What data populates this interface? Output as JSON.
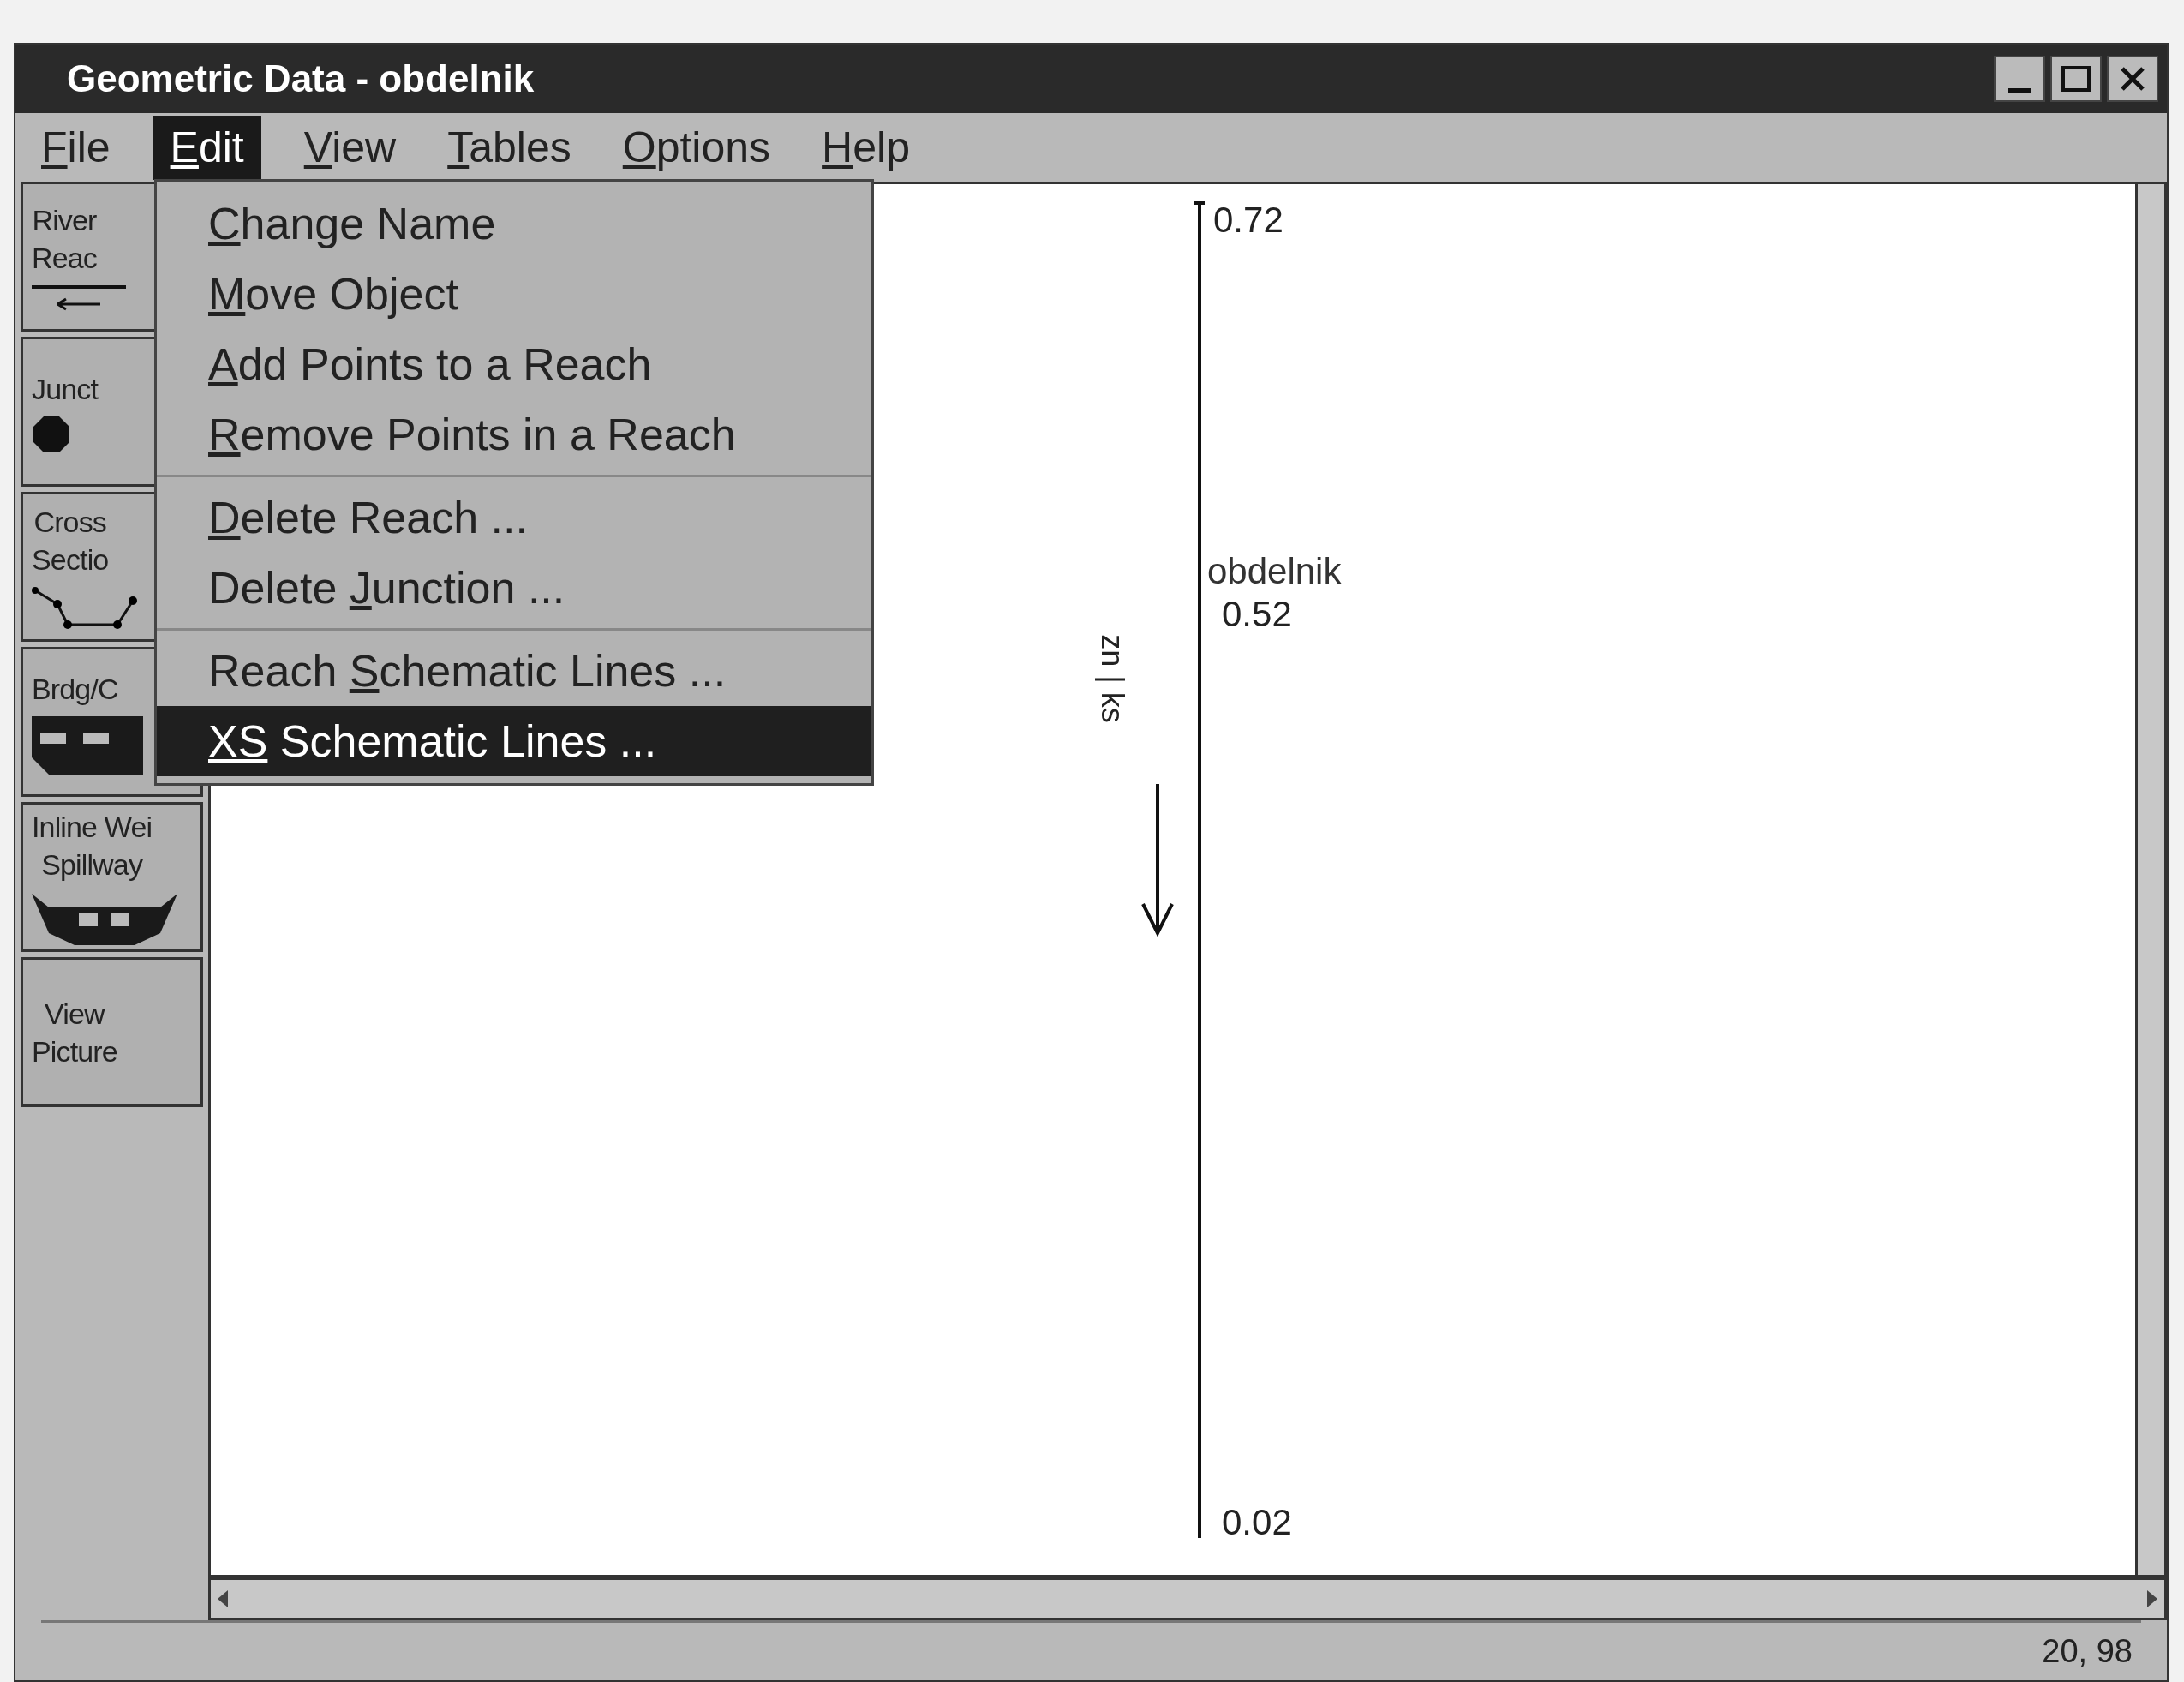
{
  "window": {
    "title": "Geometric Data - obdelnik"
  },
  "menu_bar": [
    {
      "key": "F",
      "after": "ile",
      "selected": false
    },
    {
      "key": "E",
      "after": "dit",
      "selected": true
    },
    {
      "key": "V",
      "after": "iew",
      "selected": false
    },
    {
      "key": "T",
      "after": "ables",
      "selected": false
    },
    {
      "key": "O",
      "after": "ptions",
      "selected": false
    },
    {
      "key": "H",
      "after": "elp",
      "selected": false
    }
  ],
  "edit_menu": [
    [
      {
        "key": "C",
        "after": "hange Name",
        "selected": false
      },
      {
        "key": "M",
        "after": "ove Object",
        "selected": false
      },
      {
        "key": "A",
        "after": "dd Points to a Reach",
        "selected": false
      },
      {
        "key": "R",
        "after": "emove Points in a Reach",
        "selected": false
      }
    ],
    [
      {
        "key": "D",
        "after": "elete Reach ...",
        "selected": false
      },
      {
        "before": "Delete ",
        "key": "J",
        "after": "unction ...",
        "selected": false
      }
    ],
    [
      {
        "before": "Reach ",
        "key": "S",
        "after": "chematic Lines ...",
        "selected": false
      },
      {
        "key": "XS",
        "after": " Schematic Lines ...",
        "selected": true
      }
    ]
  ],
  "toolbar": [
    {
      "label": "River\nReac",
      "kind": "arrow"
    },
    {
      "label": "Junct",
      "kind": "dot"
    },
    {
      "label": "Cross\nSectio",
      "kind": "section"
    },
    {
      "label": "Brdg/C",
      "kind": "bridge"
    },
    {
      "label": "Inline Wei\nSpillway",
      "kind": "weir"
    },
    {
      "label": "View\nPicture",
      "kind": "none"
    }
  ],
  "canvas": {
    "ticks": [
      "0.72",
      "0.52",
      "0.02"
    ],
    "reach_label": "obdelnik",
    "section_label": "zn | ks"
  },
  "status_bar": {
    "coordinates": "20, 98"
  }
}
